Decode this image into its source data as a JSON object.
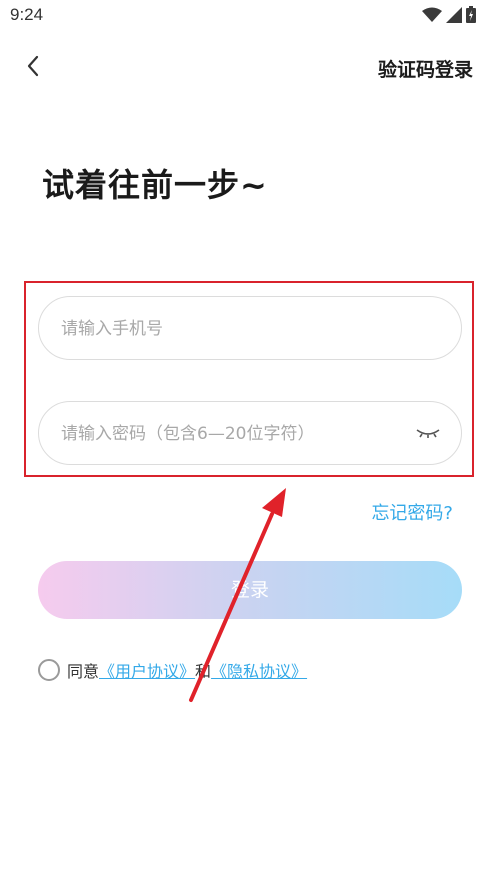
{
  "status_bar": {
    "time": "9:24",
    "icons": [
      "wifi-icon",
      "cell-signal-icon",
      "battery-icon"
    ]
  },
  "header": {
    "back_icon": "chevron-left-icon",
    "sms_login_label": "验证码登录"
  },
  "main": {
    "title": "试着往前一步~",
    "phone_placeholder": "请输入手机号",
    "password_placeholder": "请输入密码（包含6—20位字符）",
    "password_toggle_icon": "eye-closed-icon",
    "forgot_password_label": "忘记密码?",
    "login_button_label": "登录"
  },
  "agreement": {
    "agree_prefix": "同意",
    "user_agreement_label": "《用户协议》",
    "conjunction": "和",
    "privacy_policy_label": "《隐私协议》"
  },
  "annotation": {
    "highlight_color": "#d9232c",
    "arrow_color": "#e0222a"
  },
  "colors": {
    "accent_link": "#34a9e8",
    "button_gradient": [
      "#f6cbee",
      "#c9d3f1",
      "#a6dcf8"
    ]
  }
}
